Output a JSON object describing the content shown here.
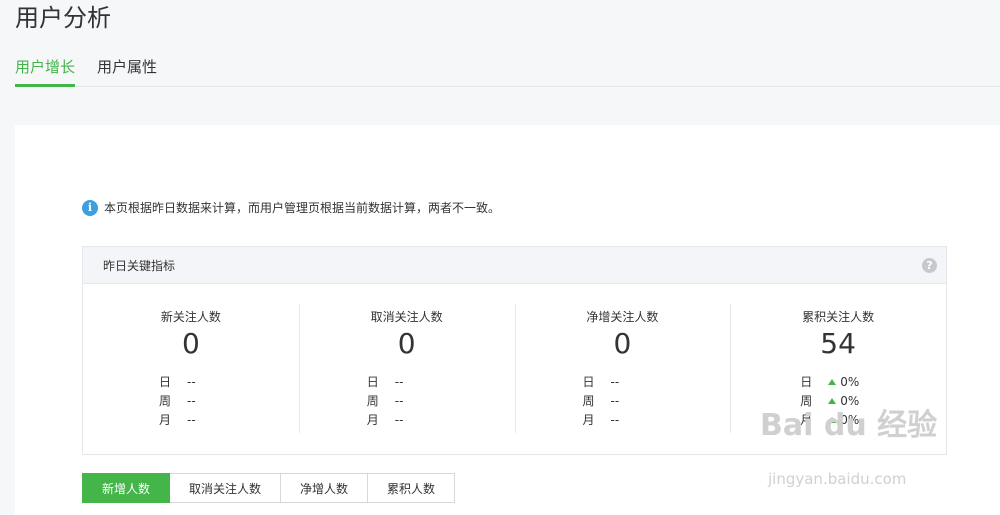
{
  "page": {
    "title": "用户分析"
  },
  "tabs": [
    {
      "label": "用户增长",
      "active": true
    },
    {
      "label": "用户属性",
      "active": false
    }
  ],
  "notice": {
    "icon": "info-icon",
    "text": "本页根据昨日数据来计算，而用户管理页根据当前数据计算，两者不一致。"
  },
  "panel": {
    "title": "昨日关键指标",
    "help_icon": "?",
    "metrics": [
      {
        "label": "新关注人数",
        "value": "0",
        "rows": [
          {
            "label": "日",
            "value": "--"
          },
          {
            "label": "周",
            "value": "--"
          },
          {
            "label": "月",
            "value": "--"
          }
        ]
      },
      {
        "label": "取消关注人数",
        "value": "0",
        "rows": [
          {
            "label": "日",
            "value": "--"
          },
          {
            "label": "周",
            "value": "--"
          },
          {
            "label": "月",
            "value": "--"
          }
        ]
      },
      {
        "label": "净增关注人数",
        "value": "0",
        "rows": [
          {
            "label": "日",
            "value": "--"
          },
          {
            "label": "周",
            "value": "--"
          },
          {
            "label": "月",
            "value": "--"
          }
        ]
      },
      {
        "label": "累积关注人数",
        "value": "54",
        "rows": [
          {
            "label": "日",
            "value": "0%"
          },
          {
            "label": "周",
            "value": "0%"
          },
          {
            "label": "月",
            "value": "0%"
          }
        ]
      }
    ]
  },
  "buttons": [
    {
      "label": "新增人数",
      "active": true
    },
    {
      "label": "取消关注人数",
      "active": false
    },
    {
      "label": "净增人数",
      "active": false
    },
    {
      "label": "累积人数",
      "active": false
    }
  ],
  "watermark": {
    "text": "Bai du 经验",
    "sub": "jingyan.baidu.com"
  },
  "colors": {
    "accent": "#44b549",
    "info": "#3e9fe0",
    "border": "#e4e8eb"
  }
}
